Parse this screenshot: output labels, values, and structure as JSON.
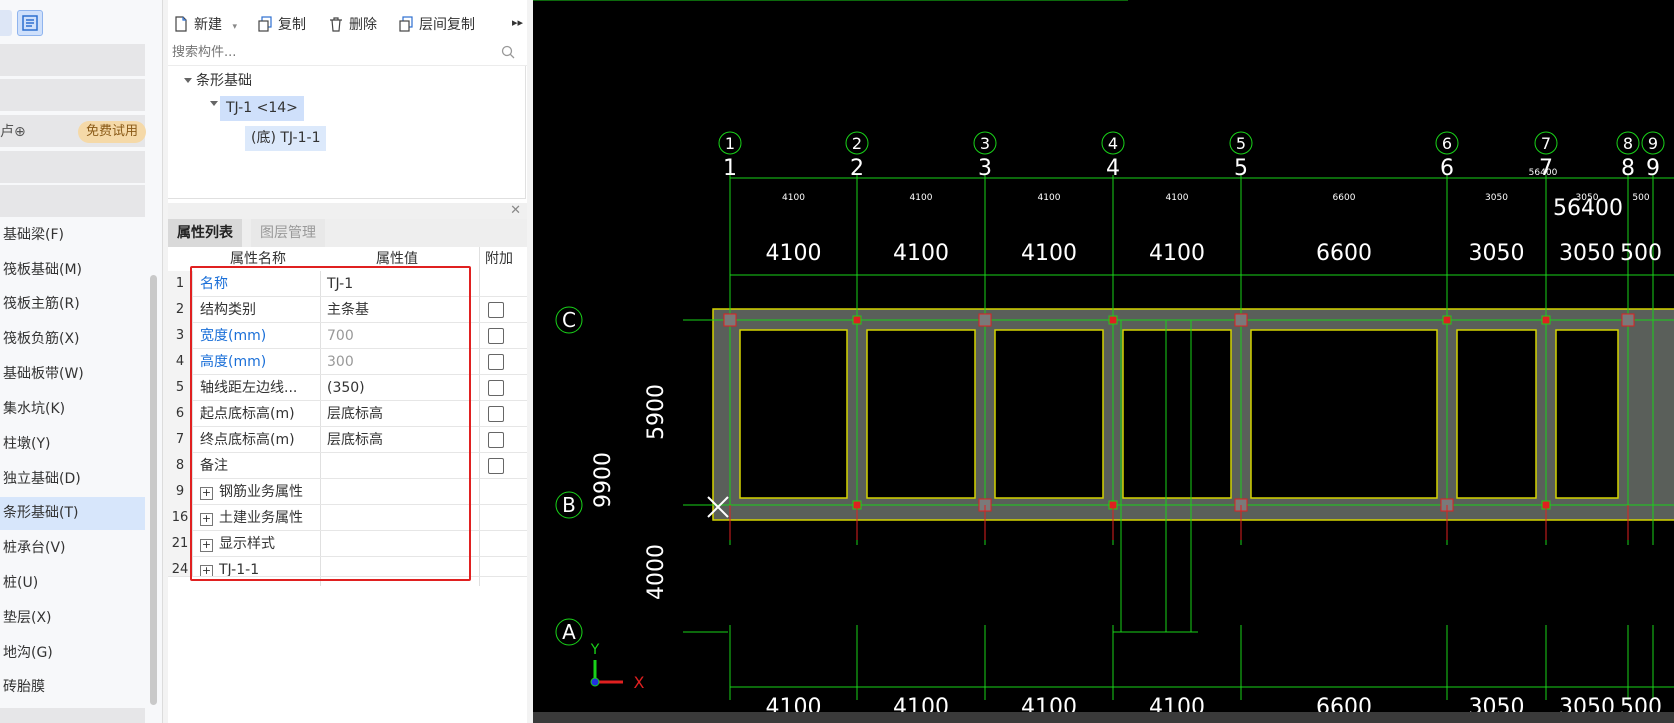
{
  "left_nav": {
    "lock_icon": "卢⊕",
    "free_badge": "免费试用",
    "items": [
      {
        "label": "基础梁(F)"
      },
      {
        "label": "筏板基础(M)"
      },
      {
        "label": "筏板主筋(R)"
      },
      {
        "label": "筏板负筋(X)"
      },
      {
        "label": "基础板带(W)"
      },
      {
        "label": "集水坑(K)"
      },
      {
        "label": "柱墩(Y)"
      },
      {
        "label": "独立基础(D)"
      },
      {
        "label": "条形基础(T)",
        "selected": true
      },
      {
        "label": "桩承台(V)"
      },
      {
        "label": "桩(U)"
      },
      {
        "label": "垫层(X)"
      },
      {
        "label": "地沟(G)"
      },
      {
        "label": "砖胎膜"
      }
    ]
  },
  "toolbar": {
    "new_label": "新建",
    "copy_label": "复制",
    "delete_label": "删除",
    "floor_copy_label": "层间复制",
    "more": "▸▸"
  },
  "search": {
    "placeholder": "搜索构件..."
  },
  "tree": {
    "root": "条形基础",
    "child": "TJ-1 <14>",
    "leaf": "(底) TJ-1-1"
  },
  "panel_tabs": {
    "properties": "属性列表",
    "layers": "图层管理"
  },
  "prop_table": {
    "headers": {
      "name": "属性名称",
      "value": "属性值",
      "extra": "附加"
    },
    "rows": [
      {
        "num": "1",
        "name": "名称",
        "value": "TJ-1",
        "blue": true,
        "grey_value": false,
        "check": false
      },
      {
        "num": "2",
        "name": "结构类别",
        "value": "主条基",
        "blue": false,
        "grey_value": false,
        "check": true
      },
      {
        "num": "3",
        "name": "宽度(mm)",
        "value": "700",
        "blue": true,
        "grey_value": true,
        "check": true
      },
      {
        "num": "4",
        "name": "高度(mm)",
        "value": "300",
        "blue": true,
        "grey_value": true,
        "check": true
      },
      {
        "num": "5",
        "name": "轴线距左边线...",
        "value": "(350)",
        "blue": false,
        "grey_value": false,
        "check": true
      },
      {
        "num": "6",
        "name": "起点底标高(m)",
        "value": "层底标高",
        "blue": false,
        "grey_value": false,
        "check": true
      },
      {
        "num": "7",
        "name": "终点底标高(m)",
        "value": "层底标高",
        "blue": false,
        "grey_value": false,
        "check": true
      },
      {
        "num": "8",
        "name": "备注",
        "value": "",
        "blue": false,
        "grey_value": false,
        "check": true
      },
      {
        "num": "9",
        "name": "钢筋业务属性",
        "value": "",
        "expander": true
      },
      {
        "num": "16",
        "name": "土建业务属性",
        "value": "",
        "expander": true
      },
      {
        "num": "21",
        "name": "显示样式",
        "value": "",
        "expander": true
      },
      {
        "num": "24",
        "name": "TJ-1-1",
        "value": "",
        "expander": true
      }
    ]
  },
  "cad": {
    "axis_numbers": [
      "1",
      "2",
      "3",
      "4",
      "5",
      "6",
      "7",
      "8",
      "9"
    ],
    "row_axes": [
      "C",
      "B",
      "A"
    ],
    "top_dims": [
      "4100",
      "4100",
      "4100",
      "4100",
      "6600",
      "3050",
      "3050",
      "500"
    ],
    "bottom_dims": [
      "4100",
      "4100",
      "4100",
      "4100",
      "6600",
      "3050",
      "3050",
      "500"
    ],
    "total_dim": "56400",
    "vert_dims": [
      "5900",
      "4000",
      "9900"
    ],
    "axis_marker_x": "X",
    "axis_marker_y": "Y",
    "colors": {
      "grid": "#19d219",
      "beam": "#d4d400",
      "fill": "#5a5f5a",
      "red": "#e02020"
    }
  }
}
